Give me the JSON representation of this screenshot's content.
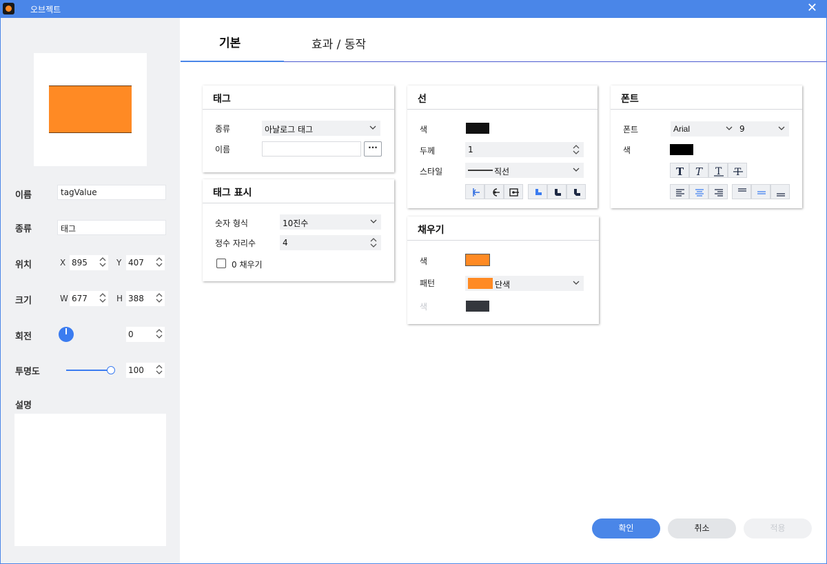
{
  "window": {
    "title": "오브젝트",
    "close_glyph": "✕"
  },
  "tabs": [
    {
      "label": "기본"
    },
    {
      "label": "효과 / 동작"
    }
  ],
  "left": {
    "name_label": "이름",
    "name_value": "tagValue",
    "type_label": "종류",
    "type_value": "태그",
    "position_label": "위치",
    "x_label": "X",
    "x_value": "895",
    "y_label": "Y",
    "y_value": "407",
    "size_label": "크기",
    "w_label": "W",
    "w_value": "677",
    "h_label": "H",
    "h_value": "388",
    "rotation_label": "회전",
    "rotation_value": "0",
    "opacity_label": "투명도",
    "opacity_value": "100",
    "opacity_level": 1.0,
    "desc_label": "설명"
  },
  "tag_card": {
    "title": "태그",
    "type_label": "종류",
    "type_value": "아날로그 태그",
    "name_label": "이름",
    "browse_label": "···"
  },
  "tag_display_card": {
    "title": "태그 표시",
    "num_format_label": "숫자 형식",
    "num_format_value": "10진수",
    "int_digits_label": "정수 자리수",
    "int_digits_value": "4",
    "zero_fill_label": "0 채우기"
  },
  "line_card": {
    "title": "선",
    "color_label": "색",
    "thickness_label": "두께",
    "thickness_value": "1",
    "style_label": "스타일",
    "style_value": "직선"
  },
  "fill_card": {
    "title": "채우기",
    "color_label": "색",
    "pattern_label": "패턴",
    "pattern_value": "단색",
    "pattern_color_label": "색"
  },
  "font_card": {
    "title": "폰트",
    "font_label": "폰트",
    "font_value": "Arial",
    "size_value": "9",
    "color_label": "색"
  },
  "buttons": {
    "ok": "확인",
    "cancel": "취소",
    "apply": "적용"
  },
  "colors": {
    "accent": "#4a86e8",
    "shape_fill": "#ff8a24",
    "line_color": "#111111",
    "pattern_color": "#34373d",
    "font_color": "#000000"
  }
}
